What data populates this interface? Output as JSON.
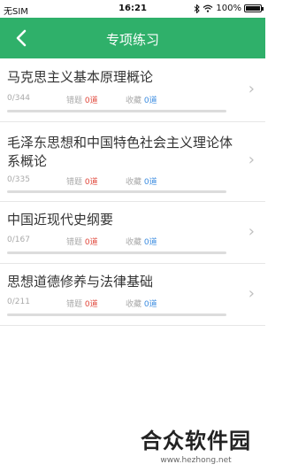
{
  "status_bar": {
    "carrier": "无SIM",
    "time": "16:21",
    "battery": "100%",
    "battery_level": 1.0
  },
  "nav": {
    "title": "专项练习",
    "back_icon": "chevron-left-icon"
  },
  "labels": {
    "wrong": "错题",
    "favorite": "收藏"
  },
  "subjects": [
    {
      "name": "马克思主义基本原理概论",
      "progress": "0/344",
      "wrong": "0道",
      "favorite": "0道"
    },
    {
      "name": "毛泽东思想和中国特色社会主义理论体系概论",
      "progress": "0/335",
      "wrong": "0道",
      "favorite": "0道"
    },
    {
      "name": "中国近现代史纲要",
      "progress": "0/167",
      "wrong": "0道",
      "favorite": "0道"
    },
    {
      "name": "思想道德修养与法律基础",
      "progress": "0/211",
      "wrong": "0道",
      "favorite": "0道"
    }
  ],
  "watermark": {
    "text": "合众软件园",
    "url": "www.hezhong.net"
  },
  "colors": {
    "accent": "#2fb06a",
    "wrong_count": "#e0463a",
    "favorite_count": "#3a8be0"
  }
}
